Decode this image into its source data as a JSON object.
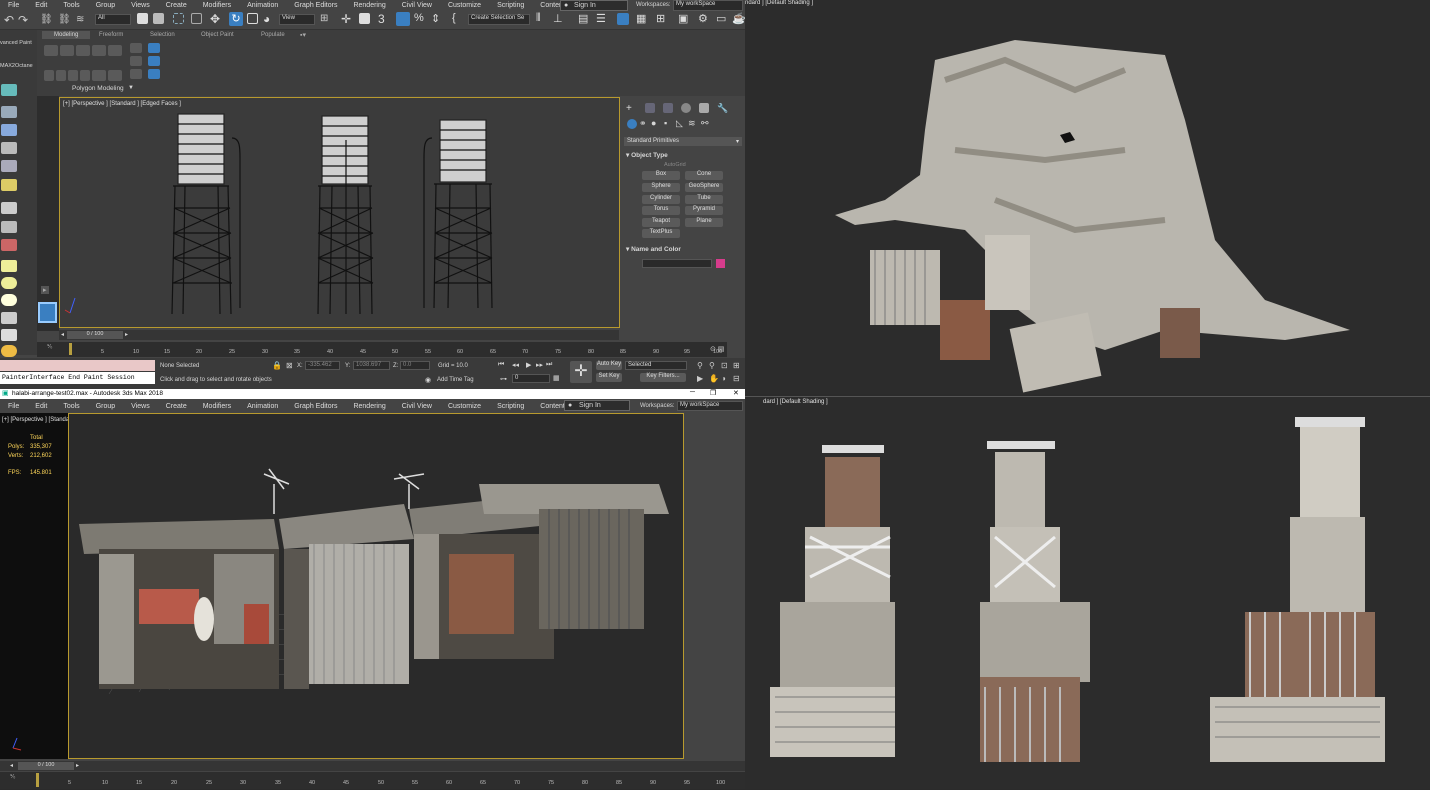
{
  "top_window": {
    "menu": [
      "File",
      "Edit",
      "Tools",
      "Group",
      "Views",
      "Create",
      "Modifiers",
      "Animation",
      "Graph Editors",
      "Rendering",
      "Civil View",
      "Customize",
      "Scripting",
      "Content"
    ],
    "selection_filter": "All",
    "view_dropdown": "View",
    "selection_set": "Create Selection Se",
    "sign_in": "Sign In",
    "workspaces_label": "Workspaces:",
    "workspace_value": "My workSpace",
    "ribbon_tabs": [
      "Modeling",
      "Freeform",
      "Selection",
      "Object Paint",
      "Populate"
    ],
    "ribbon_panel": "Polygon Modeling",
    "left_labels": [
      "vanced Paint",
      "MAX2Octane"
    ],
    "viewport_label": "[+] [Perspective ] [Standard ] [Edged Faces ]",
    "command_panel": {
      "category": "Standard Primitives",
      "object_type_title": "Object Type",
      "autogrid": "AutoGrid",
      "buttons": [
        "Box",
        "Cone",
        "Sphere",
        "GeoSphere",
        "Cylinder",
        "Tube",
        "Torus",
        "Pyramid",
        "Teapot",
        "Plane",
        "TextPlus"
      ],
      "name_color_title": "Name and Color",
      "swatch_color": "#d63c8c"
    },
    "timeslider": "0 / 100",
    "ruler": [
      "5",
      "10",
      "15",
      "20",
      "25",
      "30",
      "35",
      "40",
      "45",
      "50",
      "55",
      "60",
      "65",
      "70",
      "75",
      "80",
      "85",
      "90",
      "95",
      "100"
    ],
    "status": {
      "none_selected": "None Selected",
      "prompt": "Click and drag to select and rotate objects",
      "x_label": "X:",
      "x_value": "-335.462",
      "y_label": "Y:",
      "y_value": "1038.697",
      "z_label": "Z:",
      "z_value": "0.0",
      "grid": "Grid = 10.0",
      "add_time_tag": "Add Time Tag",
      "auto_key": "Auto Key",
      "set_key": "Set Key",
      "selected": "Selected",
      "key_filters": "Key Filters...",
      "frame": "0",
      "maxscript": "PainterInterface End Paint Session"
    }
  },
  "bottom_window": {
    "title": "halabi-arrange-test02.max - Autodesk 3ds Max 2018",
    "menu": [
      "File",
      "Edit",
      "Tools",
      "Group",
      "Views",
      "Create",
      "Modifiers",
      "Animation",
      "Graph Editors",
      "Rendering",
      "Civil View",
      "Customize",
      "Scripting",
      "Content"
    ],
    "sign_in": "Sign In",
    "workspaces_label": "Workspaces:",
    "workspace_value": "My workSpace",
    "viewport_label": "[+] [Perspective ] [Standard ] [Default Shading ]",
    "stats": {
      "total": "Total",
      "polys_label": "Polys:",
      "polys": "335,307",
      "verts_label": "Verts:",
      "verts": "212,602",
      "fps_label": "FPS:",
      "fps": "145.801"
    },
    "timeslider": "0 / 100",
    "ruler": [
      "5",
      "10",
      "15",
      "20",
      "25",
      "30",
      "35",
      "40",
      "45",
      "50",
      "55",
      "60",
      "65",
      "70",
      "75",
      "80",
      "85",
      "90",
      "95",
      "100"
    ]
  },
  "right_top_label": "ndard ] [Default Shading ]",
  "right_bottom_label": "dard ] [Default Shading ]"
}
